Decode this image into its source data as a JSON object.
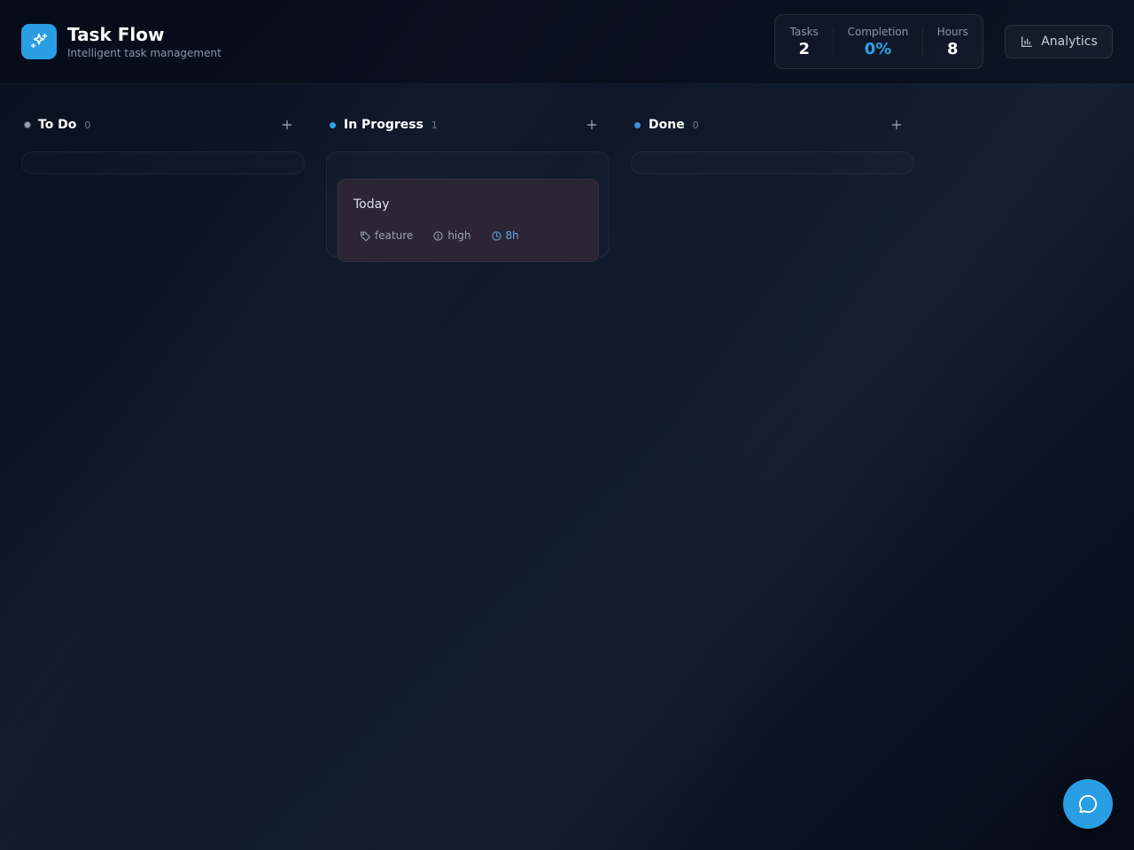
{
  "app": {
    "title": "Task Flow",
    "subtitle": "Intelligent task management",
    "logo_icon": "sparkles-icon",
    "accent": "#2a9ee3"
  },
  "stats": [
    {
      "label": "Tasks",
      "value": "2"
    },
    {
      "label": "Completion",
      "value": "0%"
    },
    {
      "label": "Hours",
      "value": "8"
    }
  ],
  "analytics_button": {
    "label": "Analytics",
    "icon": "bar-chart-icon"
  },
  "columns": [
    {
      "title": "To Do",
      "count": "0",
      "dot_color": "#9aa3b2",
      "cards": []
    },
    {
      "title": "In Progress",
      "count": "1",
      "dot_color": "#2ea0e6",
      "cards": [
        {
          "title": "Today",
          "tag": "feature",
          "priority": "high",
          "hours": "8h",
          "background": "#2b2536"
        }
      ]
    },
    {
      "title": "Done",
      "count": "0",
      "dot_color": "#3b8fd6",
      "cards": []
    }
  ],
  "chat_button": {
    "icon": "chat-bubble-icon"
  }
}
